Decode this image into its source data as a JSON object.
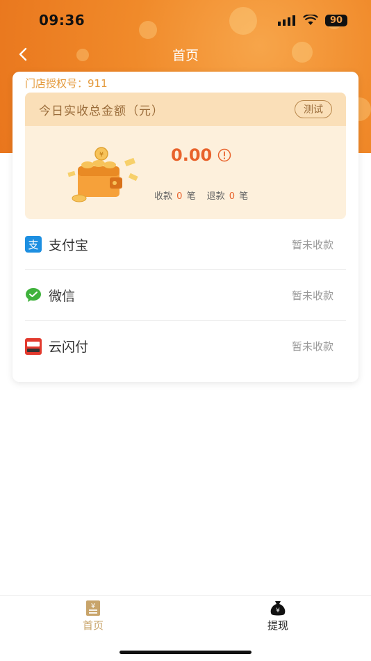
{
  "status_bar": {
    "time": "09:36",
    "battery": "90"
  },
  "nav": {
    "title": "首页"
  },
  "card": {
    "store_auth": "门店授权号：911",
    "summary": {
      "title": "今日实收总金额（元）",
      "test_label": "测试",
      "amount": "0.00",
      "receive_label": "收款",
      "receive_count": "0",
      "refund_label": "退款",
      "refund_count": "0",
      "unit": "笔"
    },
    "payments": [
      {
        "name": "支付宝",
        "status": "暂未收款",
        "icon": "alipay-icon"
      },
      {
        "name": "微信",
        "status": "暂未收款",
        "icon": "wechat-icon"
      },
      {
        "name": "云闪付",
        "status": "暂未收款",
        "icon": "unionpay-icon"
      }
    ]
  },
  "tabbar": {
    "tabs": [
      {
        "label": "首页",
        "icon": "home-ledger-icon",
        "active": true
      },
      {
        "label": "提现",
        "icon": "money-bag-icon",
        "active": false
      }
    ]
  },
  "colors": {
    "accent": "#e8622b",
    "header_orange": "#f08a2a",
    "gold": "#c8a46a"
  }
}
